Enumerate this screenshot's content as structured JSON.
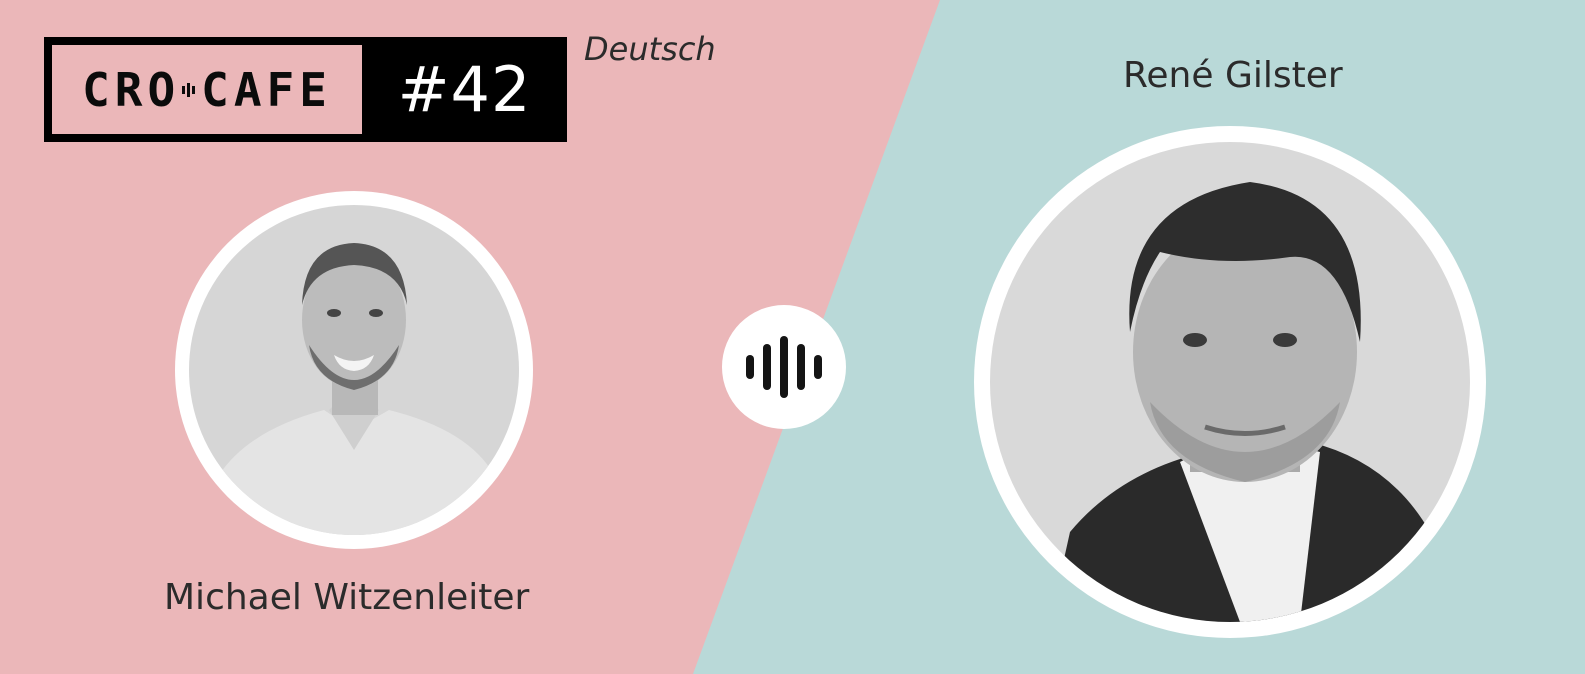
{
  "logo": {
    "word_left": "CRO",
    "word_right": "CAFE",
    "episode": "#42"
  },
  "language": "Deutsch",
  "host_name": "Michael Witzenleiter",
  "guest_name": "René Gilster",
  "icons": {
    "player": "audio-wave-icon",
    "logo_separator": "audio-wave-icon"
  },
  "colors": {
    "pink": "#ebb7b9",
    "mint": "#b9d9d8",
    "black": "#000000",
    "white": "#ffffff",
    "text": "#2b2b2b"
  }
}
